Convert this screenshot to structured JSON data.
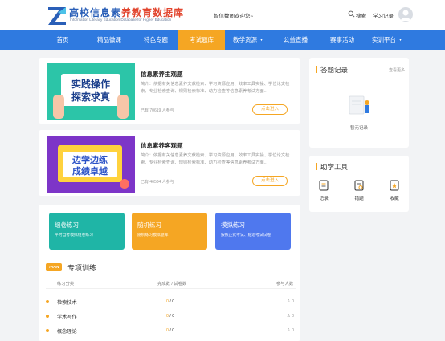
{
  "header": {
    "logo_title_a": "高校信息素",
    "logo_title_b": "养教育数据库",
    "logo_sub": "Information Literacy Education Database for Higher Education",
    "welcome": "智信数图欢迎您~",
    "search_label": "搜索",
    "record_label": "学习记录"
  },
  "nav": {
    "items": [
      {
        "label": "首页"
      },
      {
        "label": "精品微课"
      },
      {
        "label": "特色专题"
      },
      {
        "label": "考试题库"
      },
      {
        "label": "教学资源"
      },
      {
        "label": "公益直播"
      },
      {
        "label": "赛事活动"
      },
      {
        "label": "实训平台"
      }
    ],
    "active_index": 3
  },
  "courses": [
    {
      "banner_line1": "实践操作",
      "banner_line2": "探索求真",
      "title": "信息素养主观题",
      "desc": "简介：依据有关信息素养文献检索、学习资源应用、效率工具实操、学位论文检索、专业检索查询、规则检索标准、动力检查等信息素养考试方面...",
      "meta": "已有 70619 人参与",
      "button": "点击进入"
    },
    {
      "banner_line1": "边学边练",
      "banner_line2": "成绩卓越",
      "title": "信息素养客观题",
      "desc": "简介：依据有关信息素养文献检索、学习资源应用、效率工具实操、学位论文检索、专业检索查询、规则检索标准、动力检查等信息素养考试方面...",
      "meta": "已有 46584 人参与",
      "button": "点击进入"
    }
  ],
  "answer_record": {
    "title": "答题记录",
    "more": "查看更多",
    "empty": "暂无记录"
  },
  "tools": {
    "title": "助学工具",
    "items": [
      {
        "label": "记录",
        "icon": "notebook-icon"
      },
      {
        "label": "错题",
        "icon": "wrong-book-icon"
      },
      {
        "label": "收藏",
        "icon": "favorite-icon"
      }
    ]
  },
  "practice": [
    {
      "title": "组卷练习",
      "sub": "平时自考模拟组卷练习",
      "color": "#1fb5a6"
    },
    {
      "title": "随机练习",
      "sub": "随机练习模拟题库",
      "color": "#f5a623"
    },
    {
      "title": "模拟练习",
      "sub": "按照正式考试、贴近考试试卷",
      "color": "#4f78ee"
    }
  ],
  "training": {
    "badge": "TRAIN",
    "title": "专项训练",
    "headers": {
      "category": "练习分类",
      "progress": "完成数 / 试卷数",
      "people": "参与人数"
    },
    "rows": [
      {
        "name": "检索技术",
        "done": "0",
        "total": "0",
        "people": "0"
      },
      {
        "name": "学术写作",
        "done": "0",
        "total": "0",
        "people": "0"
      },
      {
        "name": "概念理论",
        "done": "0",
        "total": "0",
        "people": "0"
      }
    ]
  },
  "colors": {
    "primary": "#2f7ae0",
    "accent": "#f5a623",
    "teal": "#1fb5a6",
    "purple": "#7d35c8"
  }
}
